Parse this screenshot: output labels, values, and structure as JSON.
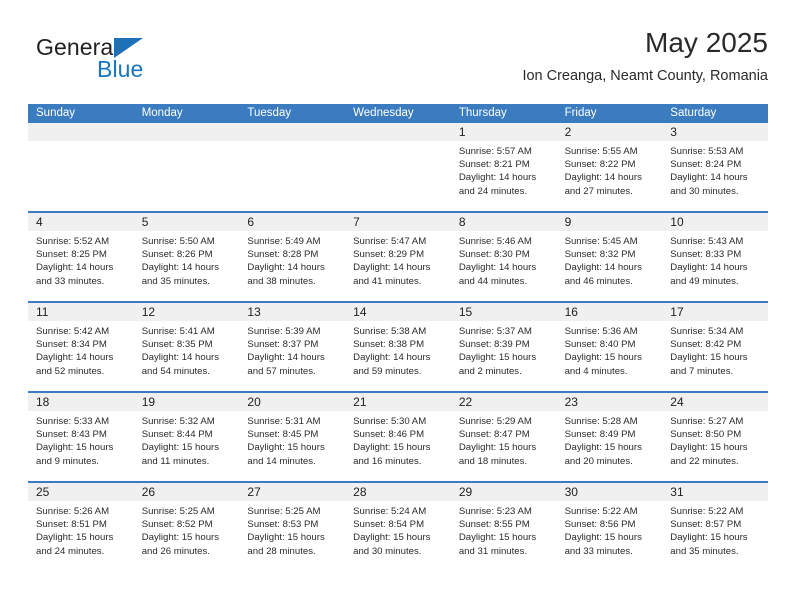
{
  "brand": {
    "name_primary": "General",
    "name_secondary": "Blue",
    "triangle_color": "#1d71b8",
    "primary_color": "#231f20",
    "secondary_color": "#1b75bb"
  },
  "header": {
    "title": "May 2025",
    "subtitle": "Ion Creanga, Neamt County, Romania"
  },
  "theme": {
    "header_bar_color": "#3a7cbf",
    "day_band_color": "#f0f0f0",
    "text_color": "#2b2b2b"
  },
  "weekdays": [
    "Sunday",
    "Monday",
    "Tuesday",
    "Wednesday",
    "Thursday",
    "Friday",
    "Saturday"
  ],
  "weeks": [
    [
      {
        "empty": true
      },
      {
        "empty": true
      },
      {
        "empty": true
      },
      {
        "empty": true
      },
      {
        "day": "1",
        "sunrise": "Sunrise: 5:57 AM",
        "sunset": "Sunset: 8:21 PM",
        "daylight1": "Daylight: 14 hours",
        "daylight2": "and 24 minutes."
      },
      {
        "day": "2",
        "sunrise": "Sunrise: 5:55 AM",
        "sunset": "Sunset: 8:22 PM",
        "daylight1": "Daylight: 14 hours",
        "daylight2": "and 27 minutes."
      },
      {
        "day": "3",
        "sunrise": "Sunrise: 5:53 AM",
        "sunset": "Sunset: 8:24 PM",
        "daylight1": "Daylight: 14 hours",
        "daylight2": "and 30 minutes."
      }
    ],
    [
      {
        "day": "4",
        "sunrise": "Sunrise: 5:52 AM",
        "sunset": "Sunset: 8:25 PM",
        "daylight1": "Daylight: 14 hours",
        "daylight2": "and 33 minutes."
      },
      {
        "day": "5",
        "sunrise": "Sunrise: 5:50 AM",
        "sunset": "Sunset: 8:26 PM",
        "daylight1": "Daylight: 14 hours",
        "daylight2": "and 35 minutes."
      },
      {
        "day": "6",
        "sunrise": "Sunrise: 5:49 AM",
        "sunset": "Sunset: 8:28 PM",
        "daylight1": "Daylight: 14 hours",
        "daylight2": "and 38 minutes."
      },
      {
        "day": "7",
        "sunrise": "Sunrise: 5:47 AM",
        "sunset": "Sunset: 8:29 PM",
        "daylight1": "Daylight: 14 hours",
        "daylight2": "and 41 minutes."
      },
      {
        "day": "8",
        "sunrise": "Sunrise: 5:46 AM",
        "sunset": "Sunset: 8:30 PM",
        "daylight1": "Daylight: 14 hours",
        "daylight2": "and 44 minutes."
      },
      {
        "day": "9",
        "sunrise": "Sunrise: 5:45 AM",
        "sunset": "Sunset: 8:32 PM",
        "daylight1": "Daylight: 14 hours",
        "daylight2": "and 46 minutes."
      },
      {
        "day": "10",
        "sunrise": "Sunrise: 5:43 AM",
        "sunset": "Sunset: 8:33 PM",
        "daylight1": "Daylight: 14 hours",
        "daylight2": "and 49 minutes."
      }
    ],
    [
      {
        "day": "11",
        "sunrise": "Sunrise: 5:42 AM",
        "sunset": "Sunset: 8:34 PM",
        "daylight1": "Daylight: 14 hours",
        "daylight2": "and 52 minutes."
      },
      {
        "day": "12",
        "sunrise": "Sunrise: 5:41 AM",
        "sunset": "Sunset: 8:35 PM",
        "daylight1": "Daylight: 14 hours",
        "daylight2": "and 54 minutes."
      },
      {
        "day": "13",
        "sunrise": "Sunrise: 5:39 AM",
        "sunset": "Sunset: 8:37 PM",
        "daylight1": "Daylight: 14 hours",
        "daylight2": "and 57 minutes."
      },
      {
        "day": "14",
        "sunrise": "Sunrise: 5:38 AM",
        "sunset": "Sunset: 8:38 PM",
        "daylight1": "Daylight: 14 hours",
        "daylight2": "and 59 minutes."
      },
      {
        "day": "15",
        "sunrise": "Sunrise: 5:37 AM",
        "sunset": "Sunset: 8:39 PM",
        "daylight1": "Daylight: 15 hours",
        "daylight2": "and 2 minutes."
      },
      {
        "day": "16",
        "sunrise": "Sunrise: 5:36 AM",
        "sunset": "Sunset: 8:40 PM",
        "daylight1": "Daylight: 15 hours",
        "daylight2": "and 4 minutes."
      },
      {
        "day": "17",
        "sunrise": "Sunrise: 5:34 AM",
        "sunset": "Sunset: 8:42 PM",
        "daylight1": "Daylight: 15 hours",
        "daylight2": "and 7 minutes."
      }
    ],
    [
      {
        "day": "18",
        "sunrise": "Sunrise: 5:33 AM",
        "sunset": "Sunset: 8:43 PM",
        "daylight1": "Daylight: 15 hours",
        "daylight2": "and 9 minutes."
      },
      {
        "day": "19",
        "sunrise": "Sunrise: 5:32 AM",
        "sunset": "Sunset: 8:44 PM",
        "daylight1": "Daylight: 15 hours",
        "daylight2": "and 11 minutes."
      },
      {
        "day": "20",
        "sunrise": "Sunrise: 5:31 AM",
        "sunset": "Sunset: 8:45 PM",
        "daylight1": "Daylight: 15 hours",
        "daylight2": "and 14 minutes."
      },
      {
        "day": "21",
        "sunrise": "Sunrise: 5:30 AM",
        "sunset": "Sunset: 8:46 PM",
        "daylight1": "Daylight: 15 hours",
        "daylight2": "and 16 minutes."
      },
      {
        "day": "22",
        "sunrise": "Sunrise: 5:29 AM",
        "sunset": "Sunset: 8:47 PM",
        "daylight1": "Daylight: 15 hours",
        "daylight2": "and 18 minutes."
      },
      {
        "day": "23",
        "sunrise": "Sunrise: 5:28 AM",
        "sunset": "Sunset: 8:49 PM",
        "daylight1": "Daylight: 15 hours",
        "daylight2": "and 20 minutes."
      },
      {
        "day": "24",
        "sunrise": "Sunrise: 5:27 AM",
        "sunset": "Sunset: 8:50 PM",
        "daylight1": "Daylight: 15 hours",
        "daylight2": "and 22 minutes."
      }
    ],
    [
      {
        "day": "25",
        "sunrise": "Sunrise: 5:26 AM",
        "sunset": "Sunset: 8:51 PM",
        "daylight1": "Daylight: 15 hours",
        "daylight2": "and 24 minutes."
      },
      {
        "day": "26",
        "sunrise": "Sunrise: 5:25 AM",
        "sunset": "Sunset: 8:52 PM",
        "daylight1": "Daylight: 15 hours",
        "daylight2": "and 26 minutes."
      },
      {
        "day": "27",
        "sunrise": "Sunrise: 5:25 AM",
        "sunset": "Sunset: 8:53 PM",
        "daylight1": "Daylight: 15 hours",
        "daylight2": "and 28 minutes."
      },
      {
        "day": "28",
        "sunrise": "Sunrise: 5:24 AM",
        "sunset": "Sunset: 8:54 PM",
        "daylight1": "Daylight: 15 hours",
        "daylight2": "and 30 minutes."
      },
      {
        "day": "29",
        "sunrise": "Sunrise: 5:23 AM",
        "sunset": "Sunset: 8:55 PM",
        "daylight1": "Daylight: 15 hours",
        "daylight2": "and 31 minutes."
      },
      {
        "day": "30",
        "sunrise": "Sunrise: 5:22 AM",
        "sunset": "Sunset: 8:56 PM",
        "daylight1": "Daylight: 15 hours",
        "daylight2": "and 33 minutes."
      },
      {
        "day": "31",
        "sunrise": "Sunrise: 5:22 AM",
        "sunset": "Sunset: 8:57 PM",
        "daylight1": "Daylight: 15 hours",
        "daylight2": "and 35 minutes."
      }
    ]
  ]
}
